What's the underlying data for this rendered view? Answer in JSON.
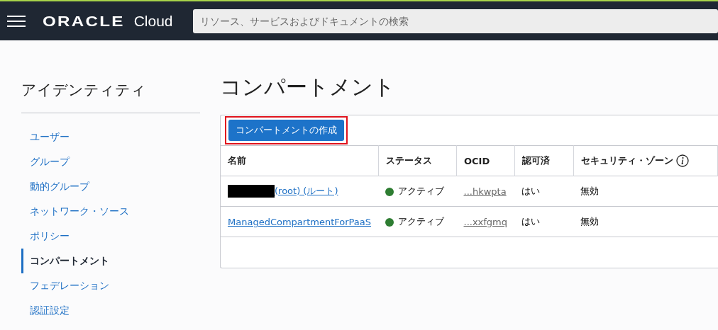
{
  "header": {
    "logo": "ORACLE",
    "product": "Cloud",
    "search": {
      "placeholder": "リソース、サービスおよびドキュメントの検索"
    }
  },
  "sidebar": {
    "title": "アイデンティティ",
    "items": [
      {
        "label": "ユーザー",
        "selected": false
      },
      {
        "label": "グループ",
        "selected": false
      },
      {
        "label": "動的グループ",
        "selected": false
      },
      {
        "label": "ネットワーク・ソース",
        "selected": false
      },
      {
        "label": "ポリシー",
        "selected": false
      },
      {
        "label": "コンパートメント",
        "selected": true
      },
      {
        "label": "フェデレーション",
        "selected": false
      },
      {
        "label": "認証設定",
        "selected": false
      }
    ]
  },
  "page_title": "コンパートメント",
  "create_button": {
    "label": "コンパートメントの作成",
    "highlighted": true
  },
  "table": {
    "columns": [
      "名前",
      "ステータス",
      "OCID",
      "認可済",
      "セキュリティ・ゾーン"
    ],
    "rows": [
      {
        "name": "(root) (ルート)",
        "redacted": true,
        "status": "アクティブ",
        "color": "#2e7d32",
        "ocid": "...hkwpta",
        "authorized": "はい",
        "security_zone": "無効"
      },
      {
        "name": "ManagedCompartmentForPaaS",
        "redacted": false,
        "status": "アクティブ",
        "color": "#2e7d32",
        "ocid": "...xxfgmq",
        "authorized": "はい",
        "security_zone": "無効"
      }
    ]
  }
}
